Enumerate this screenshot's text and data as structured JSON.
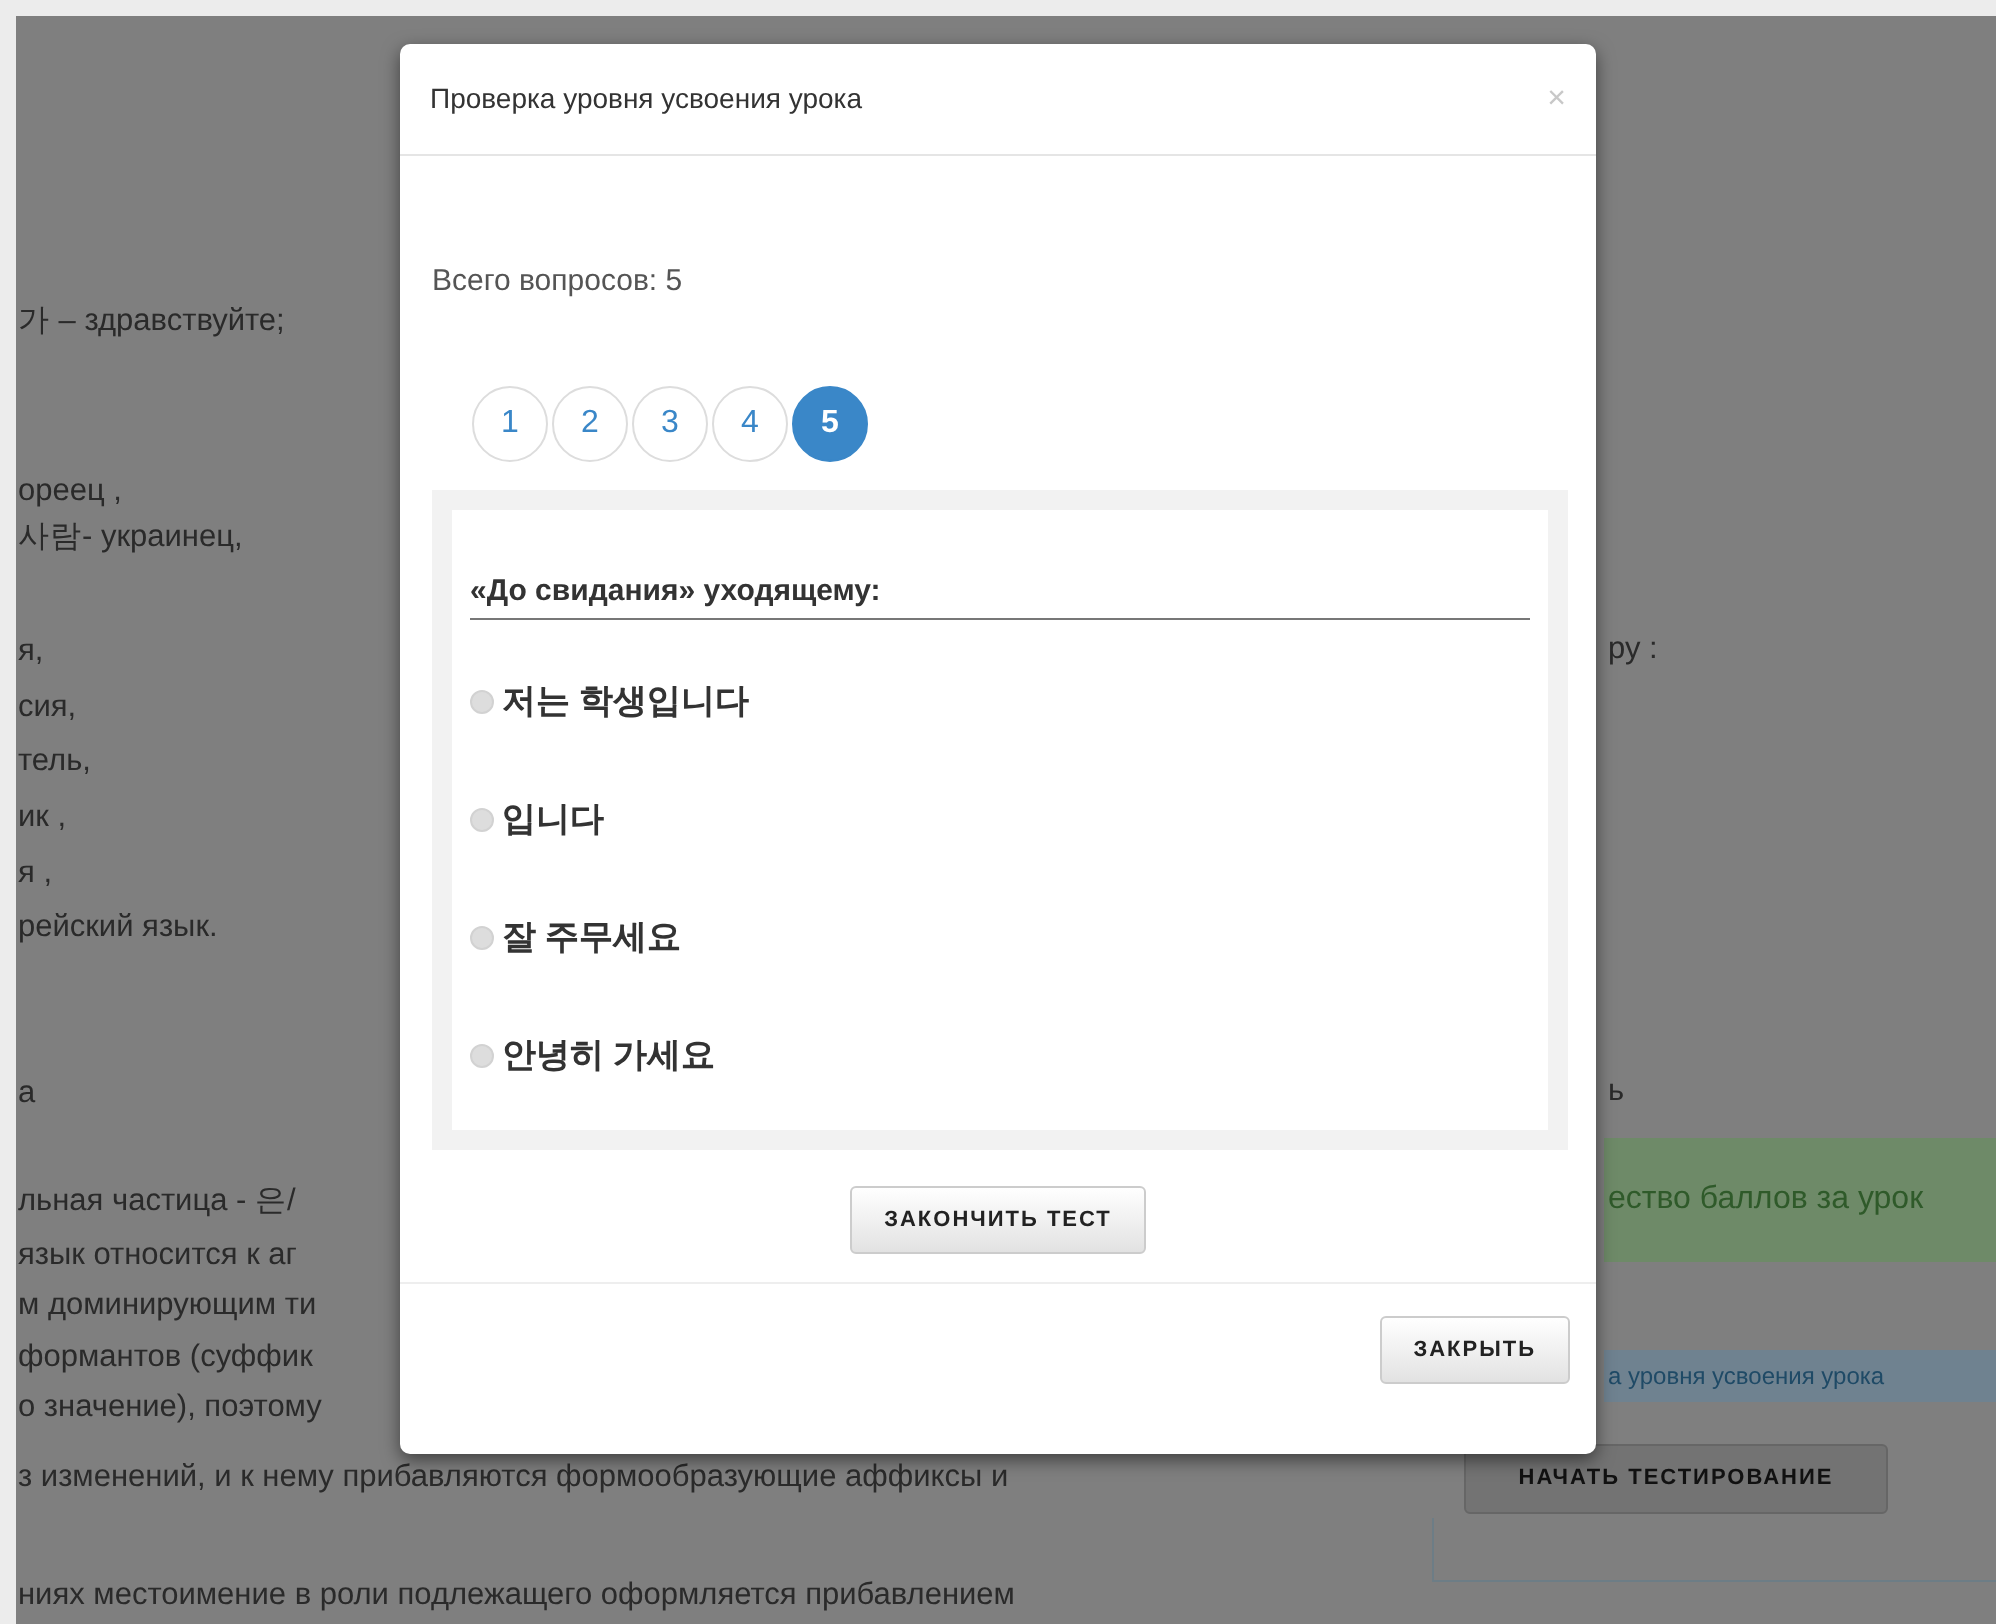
{
  "page": {
    "left_lines": [
      "가 – здравствуйте;",
      "ореец ,",
      "사람- украинец,",
      "я,",
      "сия,",
      "тель,",
      "ик ,",
      "я ,",
      "рейский язык.",
      "а",
      "льная частица - 은/",
      "язык относится к аг",
      "м доминирующим ти",
      "формантов (суффик",
      "о значение), поэтому"
    ],
    "bottom_lines": [
      "з изменений, и к нему прибавляются формообразующие аффиксы и",
      "ниях местоимение в роли подлежащего оформляется прибавлением"
    ],
    "right_lines": [
      "ру :",
      "ь"
    ],
    "score_alert": "ество баллов за урок",
    "test_alert": "а уровня усвоения урока",
    "start_button": "НАЧАТЬ ТЕСТИРОВАНИЕ"
  },
  "modal": {
    "title": "Проверка уровня усвоения урока",
    "close_icon": "×",
    "total": "Всего вопросов: 5",
    "pages": [
      {
        "label": "1",
        "selected": false
      },
      {
        "label": "2",
        "selected": false
      },
      {
        "label": "3",
        "selected": false
      },
      {
        "label": "4",
        "selected": false
      },
      {
        "label": "5",
        "selected": true
      }
    ],
    "question": "«До свидания» уходящему:",
    "options": [
      {
        "label": "저는 학생입니다",
        "selected": false
      },
      {
        "label": "입니다",
        "selected": false
      },
      {
        "label": "잘 주무세요",
        "selected": false
      },
      {
        "label": "안녕히 가세요",
        "selected": false
      }
    ],
    "finish_button": "ЗАКОНЧИТЬ ТЕСТ",
    "close_button": "ЗАКРЫТЬ"
  }
}
